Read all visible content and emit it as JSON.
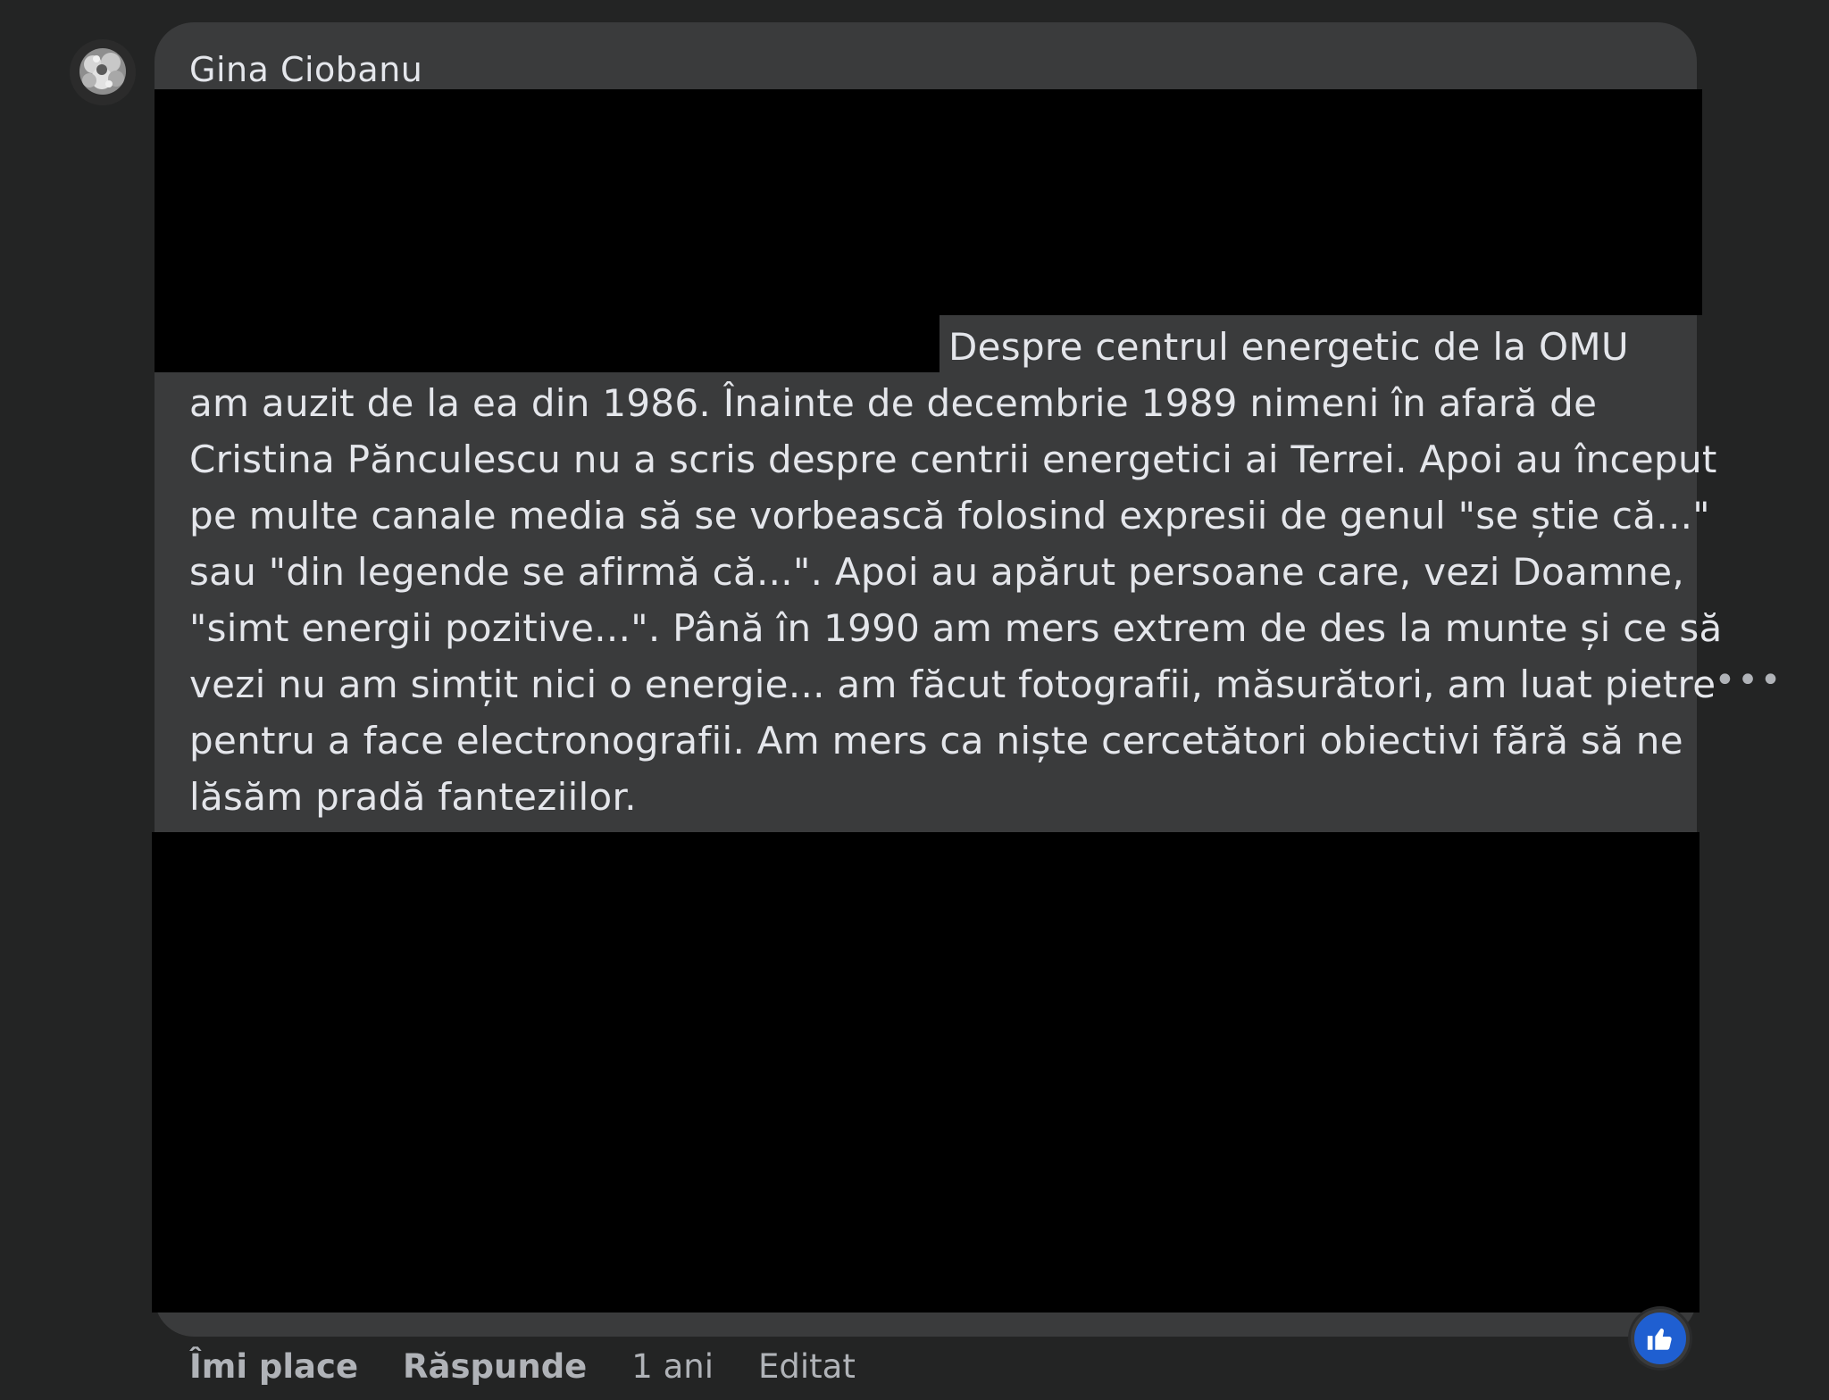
{
  "comment": {
    "author": "Gina Ciobanu",
    "text_lines": [
      "Despre centrul energetic de la OMU",
      "am auzit de la ea din 1986. Înainte de decembrie 1989 nimeni în afară de",
      "Cristina Pănculescu nu a scris despre centrii energetici ai Terrei. Apoi au început",
      "pe multe canale media să se vorbească folosind expresii de genul \"se știe că...\"",
      "sau \"din legende se afirmă că...\". Apoi au apărut persoane care, vezi Doamne,",
      "\"simt energii pozitive...\". Până în 1990 am mers extrem de des la munte și ce să",
      "vezi nu am simțit nici o energie... am făcut fotografii, măsurători, am luat pietre",
      "pentru a face electronografii. Am mers ca niște cercetători obiectivi fără să ne",
      "lăsăm pradă fanteziilor."
    ],
    "more_label": "•••",
    "like_icon": "thumbs-up-icon",
    "actions": {
      "like": "Îmi place",
      "reply": "Răspunde",
      "time": "1 ani",
      "edited": "Editat"
    }
  },
  "colors": {
    "background": "#232424",
    "bubble": "#3a3b3c",
    "text": "#e4e6eb",
    "secondary_text": "#b0b3b8",
    "like_blue": "#1f5fd1",
    "redaction": "#000000"
  }
}
